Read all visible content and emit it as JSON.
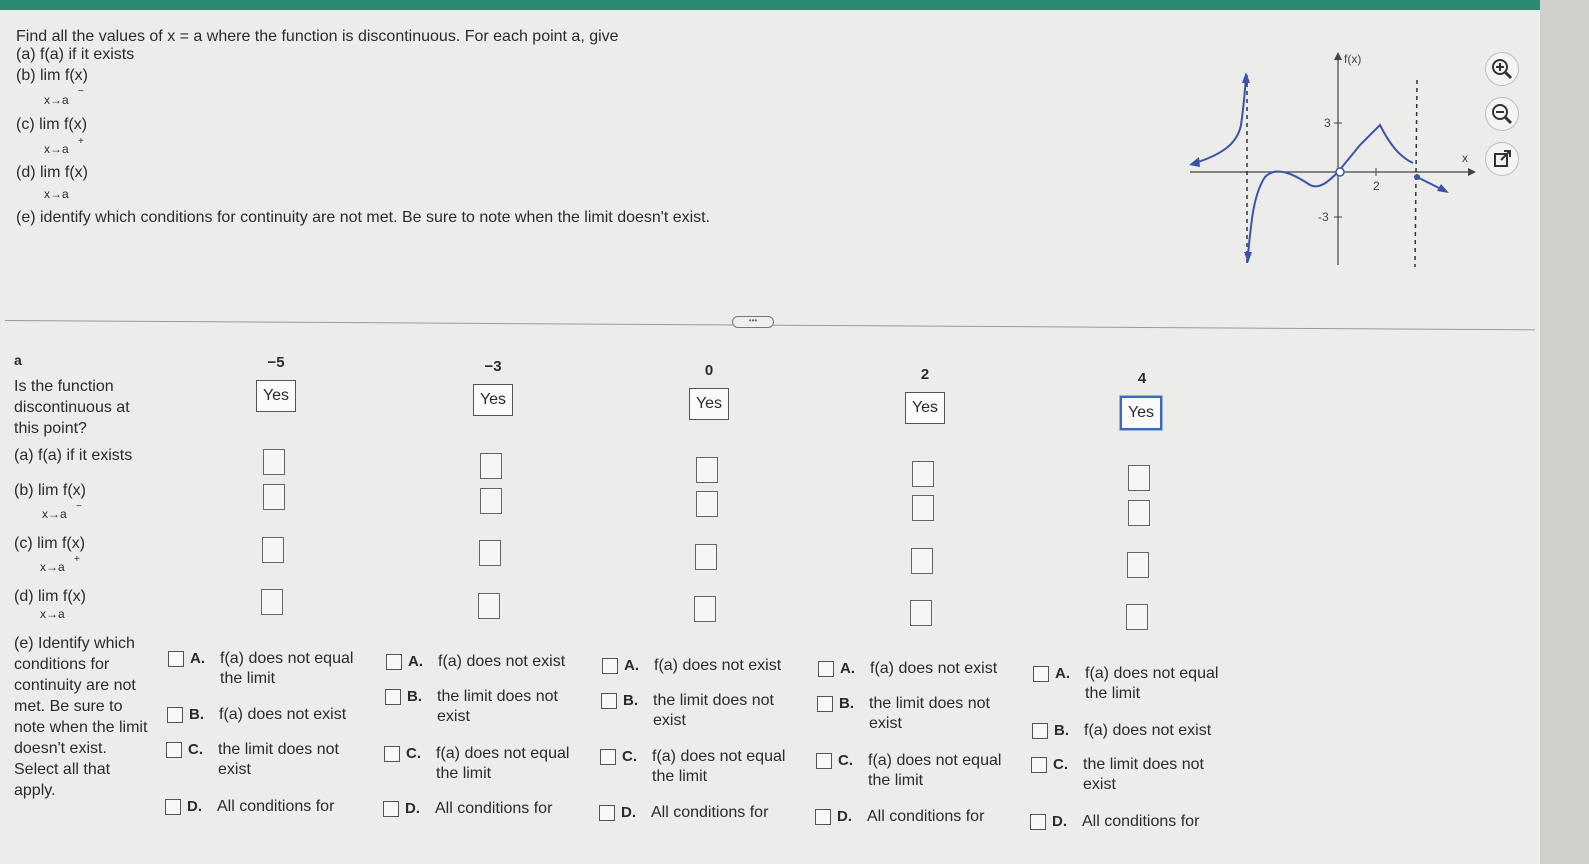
{
  "question": {
    "intro": "Find all the values of x = a where the function is discontinuous. For each point a, give",
    "a": "(a) f(a) if it exists",
    "b": "(b)  lim  f(x)",
    "b_sub": "x→a",
    "b_sign": "−",
    "c": "(c)  lim  f(x)",
    "c_sub": "x→a",
    "c_sign": "+",
    "d": "(d)  lim  f(x)",
    "d_sub": "x→a",
    "e": "(e) identify which conditions for continuity are not met. Be sure to note when the limit doesn't exist."
  },
  "graph": {
    "y_label": "f(x)",
    "x_label": "x",
    "tick_y_pos": "3",
    "tick_y_neg": "-3",
    "tick_x": "2"
  },
  "tools": {
    "zoom_in": "zoom-in-icon",
    "zoom_out": "zoom-out-icon",
    "popout": "external-link-icon"
  },
  "table": {
    "header_a": "a",
    "discontinuous_label": "Is the function discontinuous at this point?",
    "row_a": "(a) f(a) if it exists",
    "row_b": "(b)   lim  f(x)",
    "row_b_sub": "x→a",
    "row_b_sign": "−",
    "row_c": "(c)   lim  f(x)",
    "row_c_sub": "x→a",
    "row_c_sign": "+",
    "row_d": "(d)   lim  f(x)",
    "row_d_sub": "x→a",
    "row_e": "(e) Identify which conditions for continuity are not met. Be sure to note when the limit doesn't exist. Select all that apply.",
    "columns": [
      {
        "a": "−5",
        "answer": "Yes",
        "options": [
          {
            "letter": "A.",
            "text": "f(a) does not equal the limit"
          },
          {
            "letter": "B.",
            "text": "f(a) does not exist"
          },
          {
            "letter": "C.",
            "text": "the limit does not exist"
          },
          {
            "letter": "D.",
            "text": "All conditions for"
          }
        ]
      },
      {
        "a": "−3",
        "answer": "Yes",
        "options": [
          {
            "letter": "A.",
            "text": "f(a) does not exist"
          },
          {
            "letter": "B.",
            "text": "the limit does not exist"
          },
          {
            "letter": "C.",
            "text": "f(a) does not equal the limit"
          },
          {
            "letter": "D.",
            "text": "All conditions for"
          }
        ]
      },
      {
        "a": "0",
        "answer": "Yes",
        "options": [
          {
            "letter": "A.",
            "text": "f(a) does not exist"
          },
          {
            "letter": "B.",
            "text": "the limit does not exist"
          },
          {
            "letter": "C.",
            "text": "f(a) does not equal the limit"
          },
          {
            "letter": "D.",
            "text": "All conditions for"
          }
        ]
      },
      {
        "a": "2",
        "answer": "Yes",
        "options": [
          {
            "letter": "A.",
            "text": "f(a) does not exist"
          },
          {
            "letter": "B.",
            "text": "the limit does not exist"
          },
          {
            "letter": "C.",
            "text": "f(a) does not equal the limit"
          },
          {
            "letter": "D.",
            "text": "All conditions for"
          }
        ]
      },
      {
        "a": "4",
        "answer": "Yes",
        "options": [
          {
            "letter": "A.",
            "text": "f(a) does not equal the limit"
          },
          {
            "letter": "B.",
            "text": "f(a) does not exist"
          },
          {
            "letter": "C.",
            "text": "the limit does not exist"
          },
          {
            "letter": "D.",
            "text": "All conditions for"
          }
        ]
      }
    ]
  },
  "colors": {
    "accent": "#2c8a73",
    "curve": "#3a55a8",
    "selected": "#3a6bb4"
  }
}
